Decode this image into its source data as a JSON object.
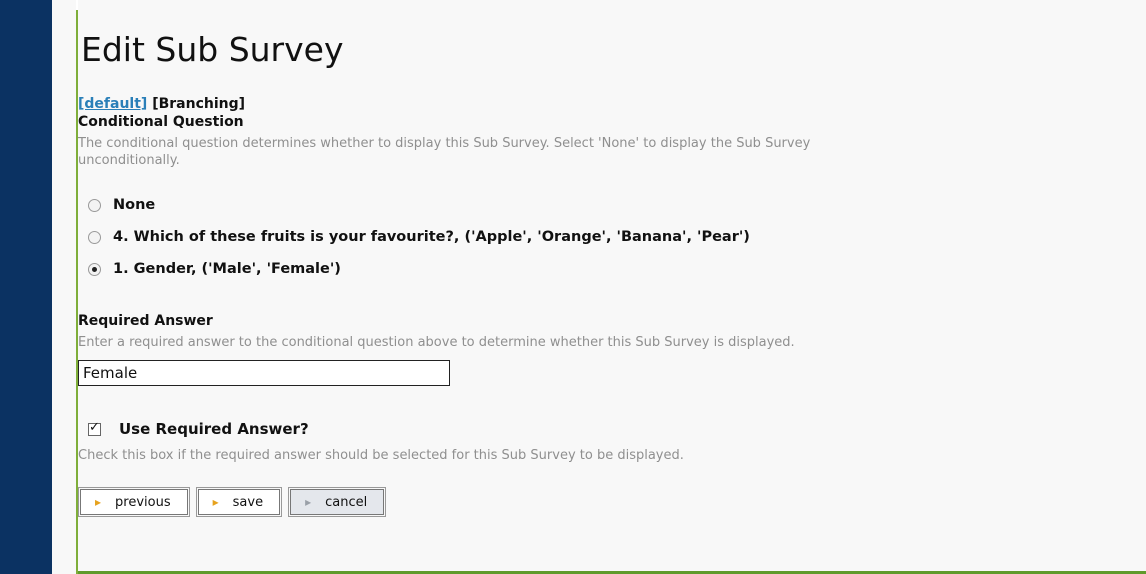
{
  "page": {
    "title": "Edit Sub Survey"
  },
  "tabs": {
    "default_label": "[default]",
    "branching_label": "[Branching]"
  },
  "conditional_question": {
    "heading": "Conditional Question",
    "help_line1": "The conditional question determines whether to display this Sub Survey. Select 'None' to display the Sub Survey",
    "help_line2": "unconditionally.",
    "options": [
      {
        "label": "None",
        "selected": false
      },
      {
        "label": "4. Which of these fruits is your favourite?, ('Apple', 'Orange', 'Banana', 'Pear')",
        "selected": false
      },
      {
        "label": "1. Gender, ('Male', 'Female')",
        "selected": true
      }
    ]
  },
  "required_answer": {
    "heading": "Required Answer",
    "help": "Enter a required answer to the conditional question above to determine whether this Sub Survey is displayed.",
    "value": "Female"
  },
  "use_required": {
    "label": "Use Required Answer?",
    "checked": true,
    "check_glyph": "✓",
    "help": "Check this box if the required answer should be selected for this Sub Survey to be displayed."
  },
  "buttons": {
    "previous_label": "previous",
    "save_label": "save",
    "cancel_label": "cancel",
    "arrow_icon": "arrow-right-icon"
  }
}
